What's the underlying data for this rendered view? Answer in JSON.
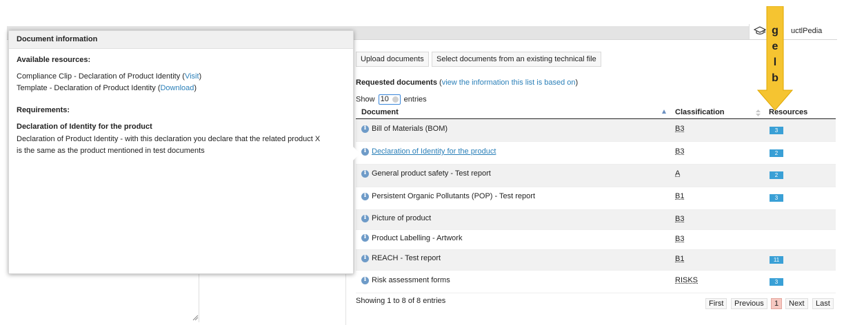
{
  "header": {
    "brand_name": "uctlPedia"
  },
  "toolbar": {
    "upload_label": "Upload documents",
    "select_label": "Select documents from an existing technical file"
  },
  "requested": {
    "title": "Requested documents",
    "paren_open": "(",
    "link_text": "view the information this list is based on",
    "paren_close": ")"
  },
  "length": {
    "show": "Show",
    "value": "10",
    "entries": "entries"
  },
  "table": {
    "headers": {
      "document": "Document",
      "classification": "Classification",
      "resources": "Resources"
    },
    "rows": [
      {
        "document": "Bill of Materials (BOM)",
        "classification": "B3",
        "resources": "3"
      },
      {
        "document": " Declaration of Identity for the product",
        "classification": "B3",
        "resources": "2"
      },
      {
        "document": "General product safety - Test report",
        "classification": "A",
        "resources": "2"
      },
      {
        "document": "Persistent Organic Pollutants (POP) - Test report",
        "classification": "B1",
        "resources": "3"
      },
      {
        "document": "Picture of product",
        "classification": "B3",
        "resources": ""
      },
      {
        "document": "Product Labelling - Artwork",
        "classification": "B3",
        "resources": ""
      },
      {
        "document": "REACH - Test report",
        "classification": "B1",
        "resources": "11"
      },
      {
        "document": "Risk assessment forms",
        "classification": "RISKS",
        "resources": "3"
      }
    ]
  },
  "footer": {
    "info": "Showing 1 to 8 of 8 entries",
    "first": "First",
    "previous": "Previous",
    "page": "1",
    "next": "Next",
    "last": "Last"
  },
  "popup": {
    "title": "Document information",
    "available_title": "Available resources:",
    "res1_text": "Compliance Clip - Declaration of Product Identity (",
    "res1_link": "Visit",
    "res1_close": ")",
    "res2_text": "Template - Declaration of Product Identity (",
    "res2_link": "Download",
    "res2_close": ")",
    "requirements_title": "Requirements:",
    "req_name": "Declaration of Identity for the product",
    "req_line1": "Declaration of Product Identity - with this declaration you declare that the related product X",
    "req_line2": "is the same as the product mentioned in test documents"
  },
  "annotation": {
    "letters": [
      "g",
      "e",
      "l",
      "b"
    ],
    "color": "#f5c431"
  },
  "colors": {
    "link": "#2a7fb8",
    "badge": "#3aa0d6",
    "current_page": "#f6c8c1"
  },
  "icons": [
    "graduation-cap-icon",
    "info-icon",
    "sort-asc-icon",
    "sort-both-icon",
    "dropdown-arrow-icon",
    "resize-grip-icon"
  ]
}
